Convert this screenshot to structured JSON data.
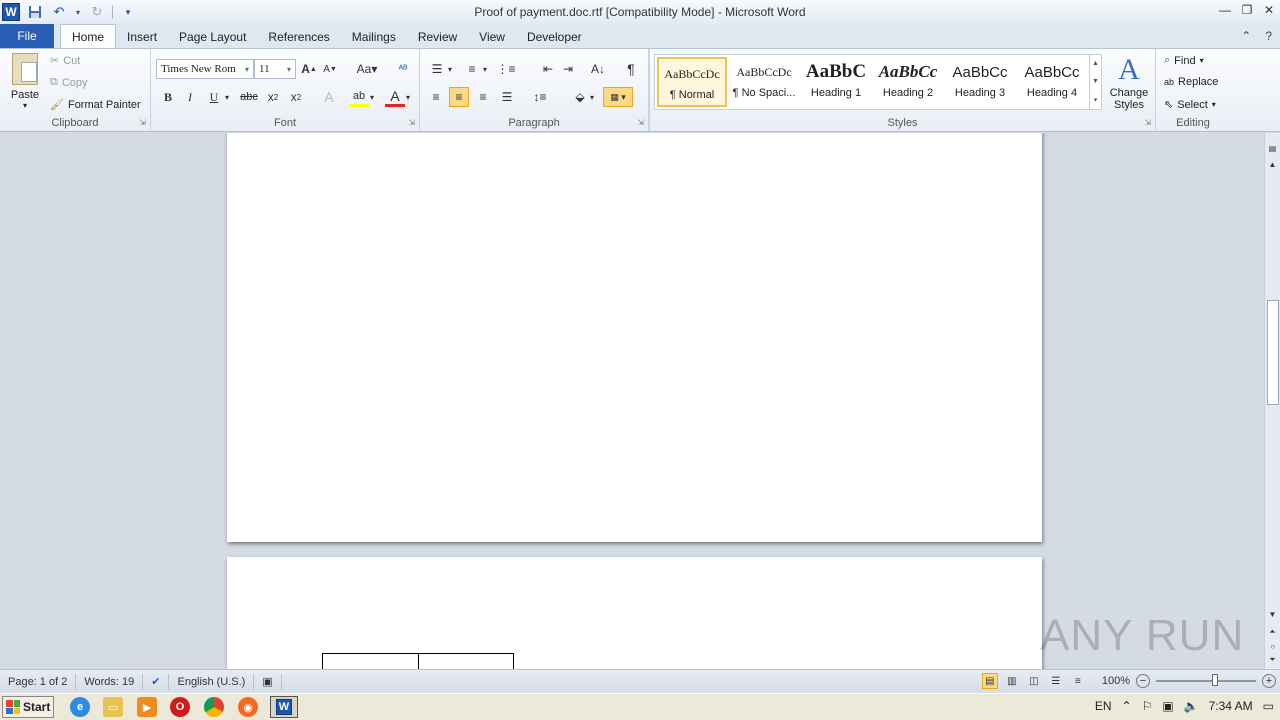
{
  "window": {
    "title": "Proof of payment.doc.rtf [Compatibility Mode] - Microsoft Word",
    "app_icon_letter": "W"
  },
  "tabs": [
    "File",
    "Home",
    "Insert",
    "Page Layout",
    "References",
    "Mailings",
    "Review",
    "View",
    "Developer"
  ],
  "clipboard": {
    "paste": "Paste",
    "cut": "Cut",
    "copy": "Copy",
    "format_painter": "Format Painter",
    "label": "Clipboard"
  },
  "font": {
    "name": "Times New Rom",
    "size": "11",
    "label": "Font"
  },
  "paragraph": {
    "label": "Paragraph"
  },
  "styles": {
    "label": "Styles",
    "items": [
      {
        "sample": "AaBbCcDc",
        "name": "¶ Normal"
      },
      {
        "sample": "AaBbCcDc",
        "name": "¶ No Spaci..."
      },
      {
        "sample": "AaBbC",
        "name": "Heading 1"
      },
      {
        "sample": "AaBbCc",
        "name": "Heading 2"
      },
      {
        "sample": "AaBbCc",
        "name": "Heading 3"
      },
      {
        "sample": "AaBbCc",
        "name": "Heading 4"
      }
    ],
    "change_styles_line1": "Change",
    "change_styles_line2": "Styles"
  },
  "editing": {
    "find": "Find",
    "replace": "Replace",
    "select": "Select",
    "label": "Editing"
  },
  "status": {
    "page": "Page: 1 of 2",
    "words": "Words: 19",
    "language": "English (U.S.)",
    "zoom": "100%"
  },
  "taskbar": {
    "start": "Start",
    "lang": "EN",
    "time": "7:34 AM"
  },
  "watermark": "ANY RUN",
  "colors": {
    "file_tab": "#2a5db4",
    "active_highlight": "#fbd985",
    "doc_background": "#d4dbe5"
  }
}
